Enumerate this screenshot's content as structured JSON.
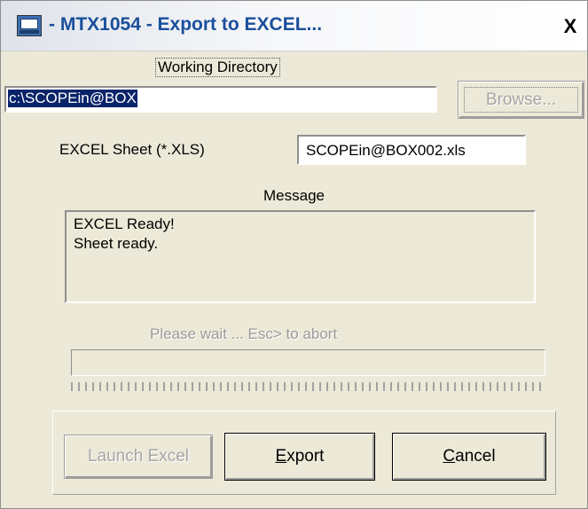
{
  "window": {
    "title": "- MTX1054 - Export to EXCEL...",
    "close_symbol": "X"
  },
  "working_directory": {
    "label": "Working Directory",
    "value": "c:\\SCOPEin@BOX",
    "browse_label": "Browse..."
  },
  "excel_sheet": {
    "label": "EXCEL Sheet (*.XLS)",
    "value": "SCOPEin@BOX002.xls"
  },
  "message": {
    "label": "Message",
    "lines": [
      "EXCEL Ready!",
      "Sheet ready."
    ]
  },
  "progress": {
    "label": "Please wait ...  Esc> to abort",
    "value": 0
  },
  "buttons": {
    "launch_excel": "Launch Excel",
    "export_prefix": "",
    "export_key": "E",
    "export_rest": "xport",
    "cancel_key": "C",
    "cancel_rest": "ancel"
  },
  "colors": {
    "title_text": "#1a4f9b",
    "dialog_bg": "#ECE9D8",
    "selection_bg": "#0a246a"
  },
  "icons": {
    "app": "app-window-icon",
    "close": "close-icon"
  }
}
